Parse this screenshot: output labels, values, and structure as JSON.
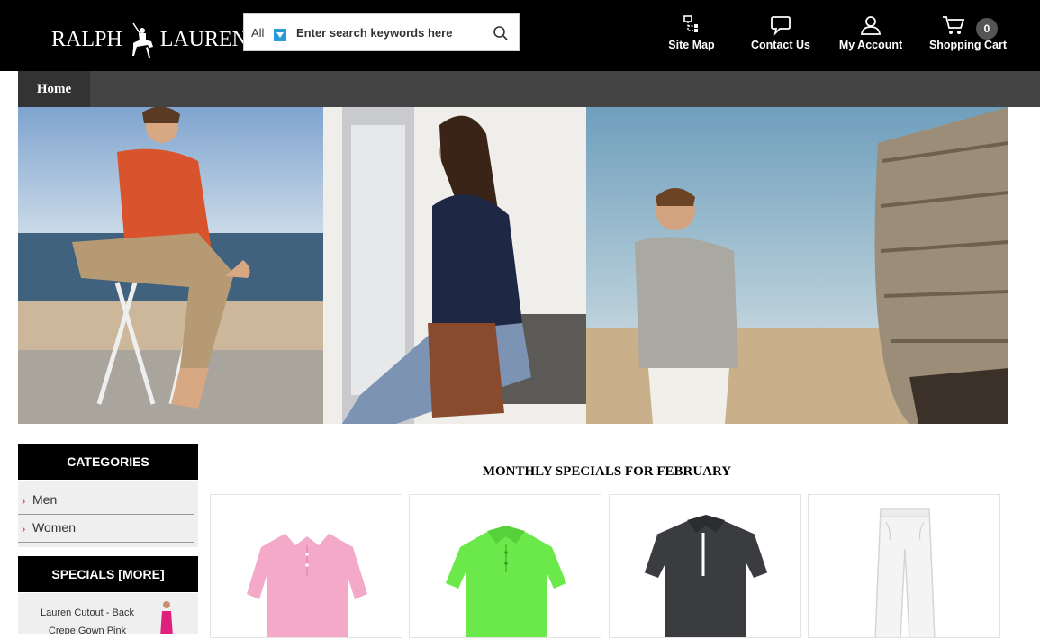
{
  "brand": {
    "logo_text_1": "RALPH",
    "logo_text_2": "LAUREN"
  },
  "search": {
    "category": "All",
    "placeholder": "Enter search keywords here"
  },
  "nav": {
    "site_map": "Site Map",
    "contact_us": "Contact Us",
    "my_account": "My Account",
    "shopping_cart": "Shopping Cart",
    "cart_count": "0"
  },
  "menu": {
    "home": "Home"
  },
  "sidebar": {
    "categories_title": "CATEGORIES",
    "categories": [
      "Men",
      "Women"
    ],
    "specials_title": "SPECIALS  [MORE]",
    "special_item": {
      "line1": "Lauren Cutout - Back",
      "line2": "Crepe Gown Pink"
    }
  },
  "main": {
    "section_title": "MONTHLY SPECIALS FOR FEBRUARY",
    "products": [
      {
        "icon": "pink-polo-shirt",
        "color": "#f4a9c8"
      },
      {
        "icon": "green-polo-shirt",
        "color": "#6be84a"
      },
      {
        "icon": "charcoal-polo-shirt",
        "color": "#3b3c40"
      },
      {
        "icon": "white-trousers",
        "color": "#f4f4f4"
      }
    ]
  },
  "colors": {
    "header_bg": "#000000",
    "menubar_bg": "#444444",
    "accent_blue": "#2a9ad6",
    "arrow_red": "#cc3333"
  }
}
